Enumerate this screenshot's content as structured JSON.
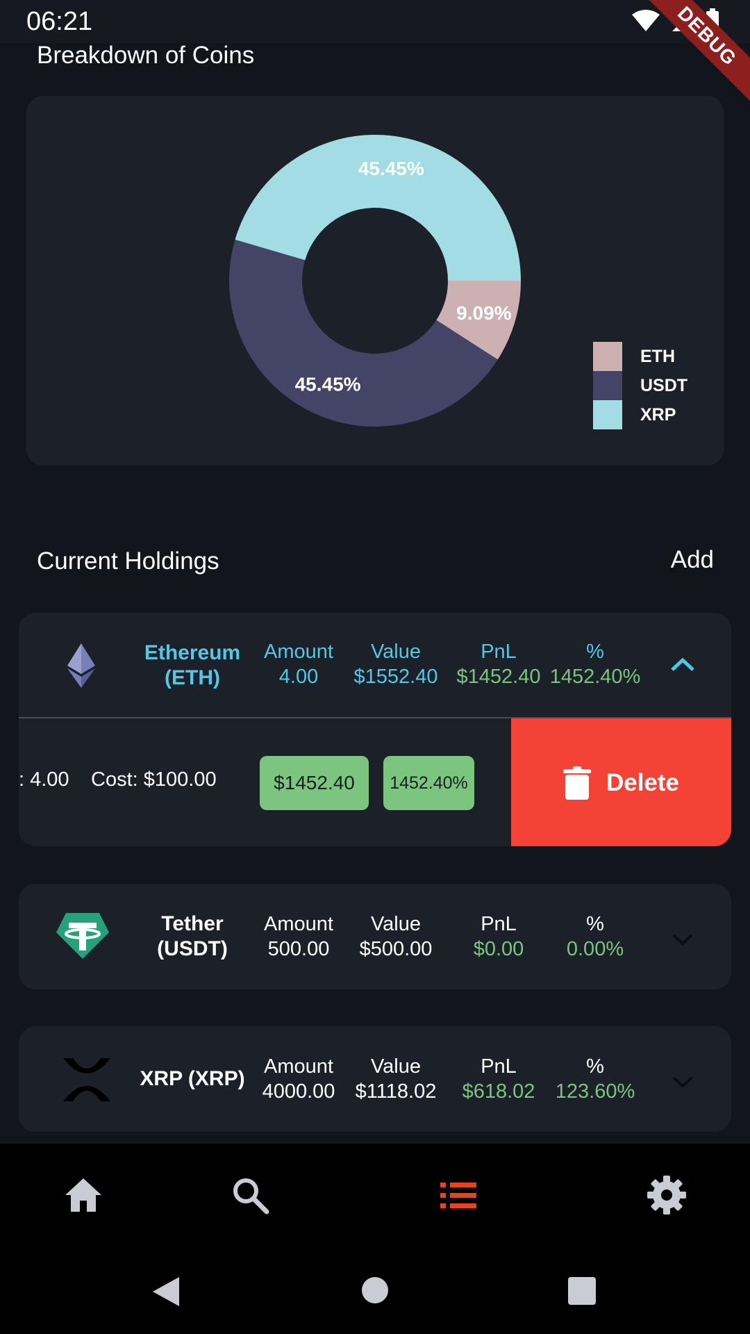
{
  "status_bar": {
    "time": "06:21",
    "debug_label": "DEBUG"
  },
  "breakdown": {
    "title": "Breakdown of Coins",
    "chart_data": {
      "type": "pie",
      "donut": true,
      "categories": [
        "ETH",
        "USDT",
        "XRP"
      ],
      "values": [
        9.09,
        45.45,
        45.45
      ],
      "labels": [
        "9.09%",
        "45.45%",
        "45.45%"
      ],
      "colors": [
        "#cdb0b1",
        "#444466",
        "#a3dde3"
      ],
      "legend_position": "bottom-right"
    }
  },
  "holdings": {
    "title": "Current Holdings",
    "add_label": "Add",
    "col_labels": {
      "amount": "Amount",
      "value": "Value",
      "pnl": "PnL",
      "percent": "%"
    },
    "items": [
      {
        "name_line1": "Ethereum",
        "name_line2": "(ETH)",
        "icon": "ethereum-icon",
        "amount": "4.00",
        "value": "$1552.40",
        "pnl": "$1452.40",
        "percent": "1452.40%",
        "expanded": true,
        "detail_amount": ": 4.00",
        "detail_cost": "Cost: $100.00",
        "detail_pnl": "$1452.40",
        "detail_percent": "1452.40%",
        "delete_label": "Delete"
      },
      {
        "name_line1": "Tether",
        "name_line2": "(USDT)",
        "icon": "tether-icon",
        "amount": "500.00",
        "value": "$500.00",
        "pnl": "$0.00",
        "percent": "0.00%"
      },
      {
        "name_line1": "XRP (XRP)",
        "icon": "xrp-icon",
        "amount": "4000.00",
        "value": "$1118.02",
        "pnl": "$618.02",
        "percent": "123.60%"
      }
    ]
  },
  "colors": {
    "accent_blue": "#55c7e6",
    "positive_green": "#7cc57e",
    "delete_red": "#f44336",
    "nav_active": "#e8431c",
    "nav_inactive": "#c9cdd3"
  },
  "bottom_nav": [
    {
      "name": "home-icon",
      "active": false
    },
    {
      "name": "search-icon",
      "active": false
    },
    {
      "name": "list-icon",
      "active": true
    },
    {
      "name": "settings-icon",
      "active": false
    }
  ]
}
